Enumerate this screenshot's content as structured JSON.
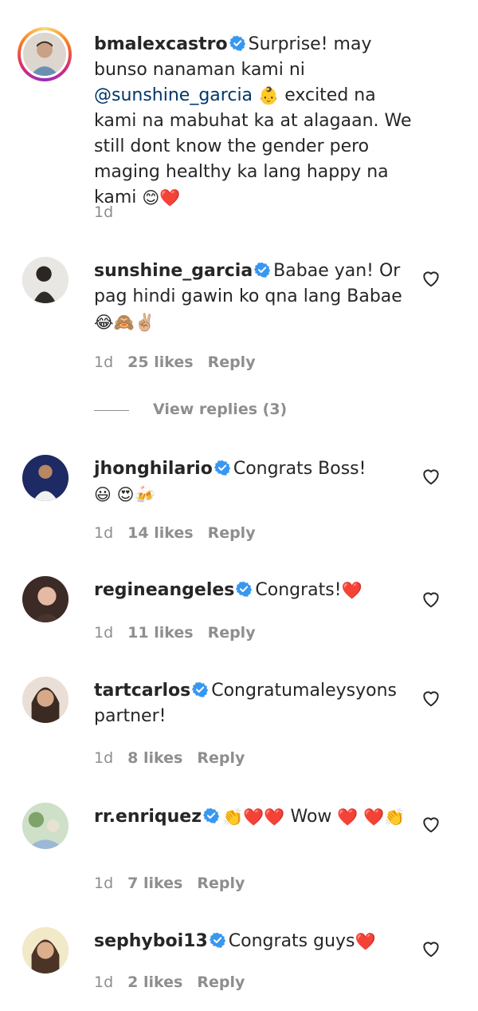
{
  "comments": [
    {
      "username": "bmalexcastro",
      "text_parts": [
        "Surprise! may bunso nanaman kami ni ",
        "@sunshine_garcia",
        " ",
        "👶",
        " excited na kami na mabuhat ka at alagaan. We still dont know the gender pero maging healthy ka lang happy na kami ",
        "😊",
        "❤️"
      ],
      "time": "1d",
      "likes": "",
      "reply": ""
    },
    {
      "username": "sunshine_garcia",
      "text": "Babae yan! Or pag hindi gawin ko qna lang Babae",
      "emojis": "😂🙈✌🏼",
      "time": "1d",
      "likes": "25 likes",
      "reply": "Reply",
      "view_replies": "View replies (3)"
    },
    {
      "username": "jhonghilario",
      "text": "Congrats Boss!",
      "emojis": " 😃 😍🍻",
      "time": "1d",
      "likes": "14 likes",
      "reply": "Reply"
    },
    {
      "username": "regineangeles",
      "text": "Congrats!",
      "emojis": "❤️",
      "time": "1d",
      "likes": "11 likes",
      "reply": "Reply"
    },
    {
      "username": "tartcarlos",
      "text": "Congratumaleysyons partner!",
      "emojis": "",
      "time": "1d",
      "likes": "8 likes",
      "reply": "Reply"
    },
    {
      "username": "rr.enriquez",
      "text_before": "👏❤️❤️",
      "text": " Wow ",
      "emojis": "❤️ ❤️👏",
      "time": "1d",
      "likes": "7 likes",
      "reply": "Reply"
    },
    {
      "username": "sephyboi13",
      "text": "Congrats guys",
      "emojis": " ❤️",
      "time": "1d",
      "likes": "2 likes",
      "reply": "Reply"
    }
  ],
  "icons": {
    "verified": "verified-badge-icon",
    "like": "heart-outline-icon"
  },
  "colors": {
    "verified_blue": "#3897f0",
    "mention": "#00376b",
    "meta_gray": "#8e8e8e",
    "text": "#262626"
  }
}
